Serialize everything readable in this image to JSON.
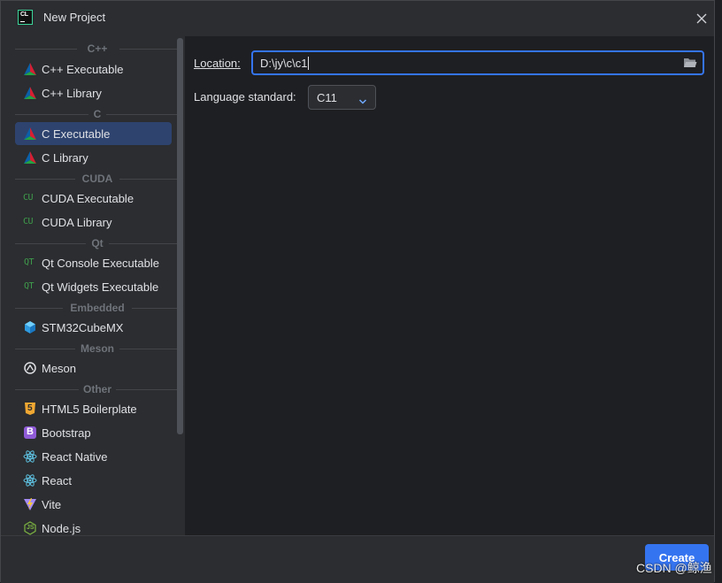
{
  "window": {
    "title": "New Project",
    "app_logo_text": "CL",
    "accent": "#3574f0"
  },
  "sidebar": {
    "sections": [
      {
        "label": "C++",
        "items": [
          {
            "label": "C++ Executable",
            "icon": "cmake-icon"
          },
          {
            "label": "C++ Library",
            "icon": "cmake-icon"
          }
        ]
      },
      {
        "label": "C",
        "items": [
          {
            "label": "C Executable",
            "icon": "cmake-icon",
            "selected": true
          },
          {
            "label": "C Library",
            "icon": "cmake-icon"
          }
        ]
      },
      {
        "label": "CUDA",
        "items": [
          {
            "label": "CUDA Executable",
            "icon": "cuda-icon",
            "glyph": "CU"
          },
          {
            "label": "CUDA Library",
            "icon": "cuda-icon",
            "glyph": "CU"
          }
        ]
      },
      {
        "label": "Qt",
        "items": [
          {
            "label": "Qt Console Executable",
            "icon": "qt-icon",
            "glyph": "QT"
          },
          {
            "label": "Qt Widgets Executable",
            "icon": "qt-icon",
            "glyph": "QT"
          }
        ]
      },
      {
        "label": "Embedded",
        "items": [
          {
            "label": "STM32CubeMX",
            "icon": "cube-icon"
          }
        ]
      },
      {
        "label": "Meson",
        "items": [
          {
            "label": "Meson",
            "icon": "meson-icon"
          }
        ]
      },
      {
        "label": "Other",
        "items": [
          {
            "label": "HTML5 Boilerplate",
            "icon": "html5-icon",
            "glyph": "5"
          },
          {
            "label": "Bootstrap",
            "icon": "bootstrap-icon",
            "glyph": "B"
          },
          {
            "label": "React Native",
            "icon": "react-icon"
          },
          {
            "label": "React",
            "icon": "react-icon"
          },
          {
            "label": "Vite",
            "icon": "vite-icon"
          },
          {
            "label": "Node.js",
            "icon": "nodejs-icon",
            "glyph": "JS"
          }
        ]
      }
    ]
  },
  "form": {
    "location_label": "Location:",
    "location_value": "D:\\jy\\c\\c1",
    "language_label": "Language standard:",
    "language_value": "C11"
  },
  "footer": {
    "create_label": "Create"
  },
  "watermark": "CSDN @鲸渔"
}
